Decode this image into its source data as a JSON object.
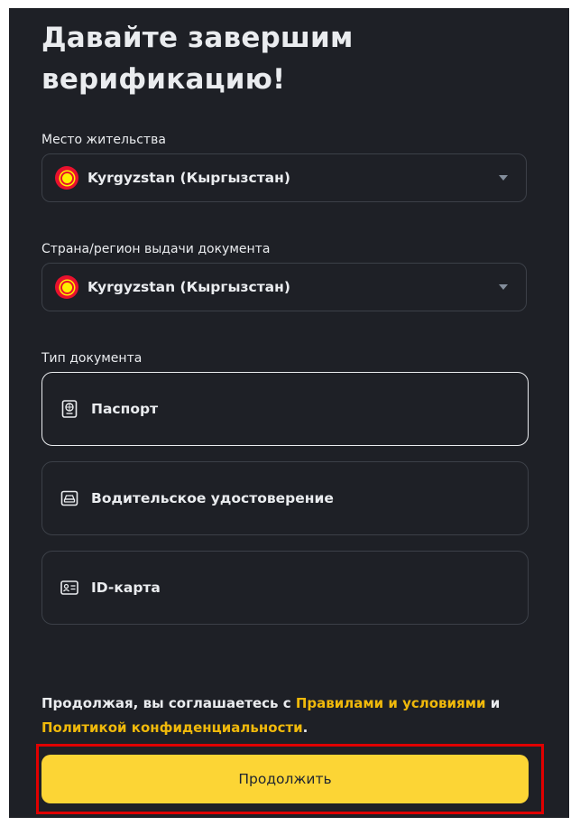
{
  "header": {
    "title_line1": "Давайте завершим",
    "title_line2": "верификацию!"
  },
  "residence": {
    "label": "Место жительства",
    "value": "Kyrgyzstan (Кыргызстан)",
    "flag_icon": "kyrgyzstan-flag"
  },
  "issuing_country": {
    "label": "Страна/регион выдачи документа",
    "value": "Kyrgyzstan (Кыргызстан)",
    "flag_icon": "kyrgyzstan-flag"
  },
  "document_type": {
    "label": "Тип документа",
    "options": [
      {
        "label": "Паспорт",
        "icon": "passport-icon",
        "selected": true
      },
      {
        "label": "Водительское удостоверение",
        "icon": "car-icon",
        "selected": false
      },
      {
        "label": "ID-карта",
        "icon": "id-card-icon",
        "selected": false
      }
    ]
  },
  "terms": {
    "prefix": "Продолжая, вы соглашаетесь с ",
    "terms_link": "Правилами и условиями",
    "conjunction": " и",
    "privacy_link": "Политикой конфиденциальности",
    "suffix": "."
  },
  "continue_button": {
    "label": "Продолжить"
  },
  "colors": {
    "background": "#1e2026",
    "accent": "#fcd535",
    "link": "#f0b90b",
    "highlight_frame": "#e00000"
  }
}
